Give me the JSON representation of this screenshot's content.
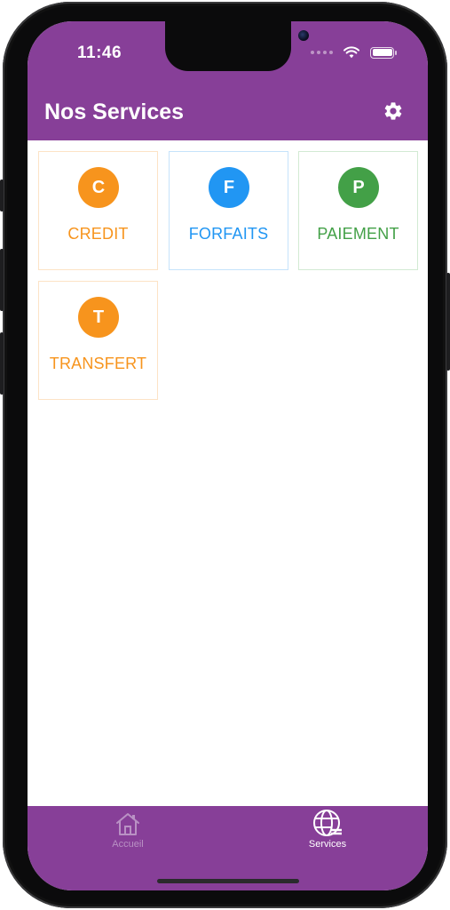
{
  "status_bar": {
    "time": "11:46"
  },
  "header": {
    "title": "Nos Services",
    "settings_icon": "gear-icon"
  },
  "services": [
    {
      "letter": "C",
      "label": "CREDIT",
      "color": "#f7941d",
      "border": "#fde3c6"
    },
    {
      "letter": "F",
      "label": "FORFAITS",
      "color": "#2196f3",
      "border": "#c6e3fb"
    },
    {
      "letter": "P",
      "label": "PAIEMENT",
      "color": "#43a047",
      "border": "#d2ead3"
    },
    {
      "letter": "T",
      "label": "TRANSFERT",
      "color": "#f7941d",
      "border": "#fde3c6"
    }
  ],
  "bottom_nav": {
    "items": [
      {
        "label": "Accueil",
        "icon": "home-icon",
        "active": false
      },
      {
        "label": "Services",
        "icon": "globe-icon",
        "active": true
      }
    ]
  },
  "colors": {
    "primary": "#873f98",
    "nav_inactive": "#b991c4",
    "nav_active": "#ffffff"
  }
}
